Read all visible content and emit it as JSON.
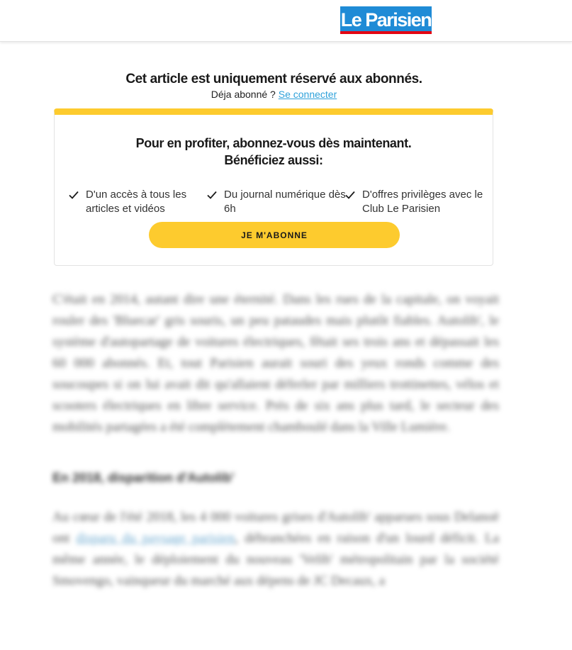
{
  "header": {
    "logo_text": "Le Parisien",
    "logo_colors": {
      "background": "#1f8bd6",
      "underline": "#e30613"
    }
  },
  "paywall": {
    "title": "Cet article est uniquement réservé aux abonnés.",
    "already_subscriber": "Déja abonné ?",
    "login_link": "Se connecter",
    "card": {
      "accent_color": "#fdcb2e",
      "title_line1": "Pour en profiter, abonnez-vous dès maintenant.",
      "title_line2": "Bénéficiez aussi:",
      "benefits": [
        {
          "icon": "check-icon",
          "text": "D'un accès à tous les articles et vidéos"
        },
        {
          "icon": "check-icon",
          "text": "Du journal numérique dès 6h"
        },
        {
          "icon": "check-icon",
          "text": "D'offres privilèges avec le Club Le Parisien"
        }
      ],
      "cta_label": "JE M'ABONNE"
    }
  },
  "article_blurred": {
    "paragraph1": "C'était en 2014, autant dire une éternité. Dans les rues de la capitale, on voyait rouler des 'Bluecar' gris souris, un peu pataudes mais plutôt fiables. Autolib', le système d'autopartage de voitures électriques, fêtait ses trois ans et dépassait les 60 000 abonnés. Et, tout Parisien aurait souri des yeux ronds comme des soucoupes si on lui avait dit qu'allaient déferler par milliers trottinettes, vélos et scooters électriques en libre service. Près de six ans plus tard, le secteur des mobilités partagées a été complètement chamboulé dans la Ville Lumière.",
    "heading": "En 2018, disparition d'Autolib'",
    "paragraph2_start": "Au cœur de l'été 2018, les 4 000 voitures grises d'Autolib' apparues sous Delanoë ont",
    "paragraph2_link": "disparu du paysage parisien",
    "paragraph2_end": ", débranchées en raison d'un lourd déficit. La même année, le déploiement du nouveau 'Velib' métropolitain par la société Smovengo, vainqueur du marché aux dépens de JC Decaux, a"
  }
}
